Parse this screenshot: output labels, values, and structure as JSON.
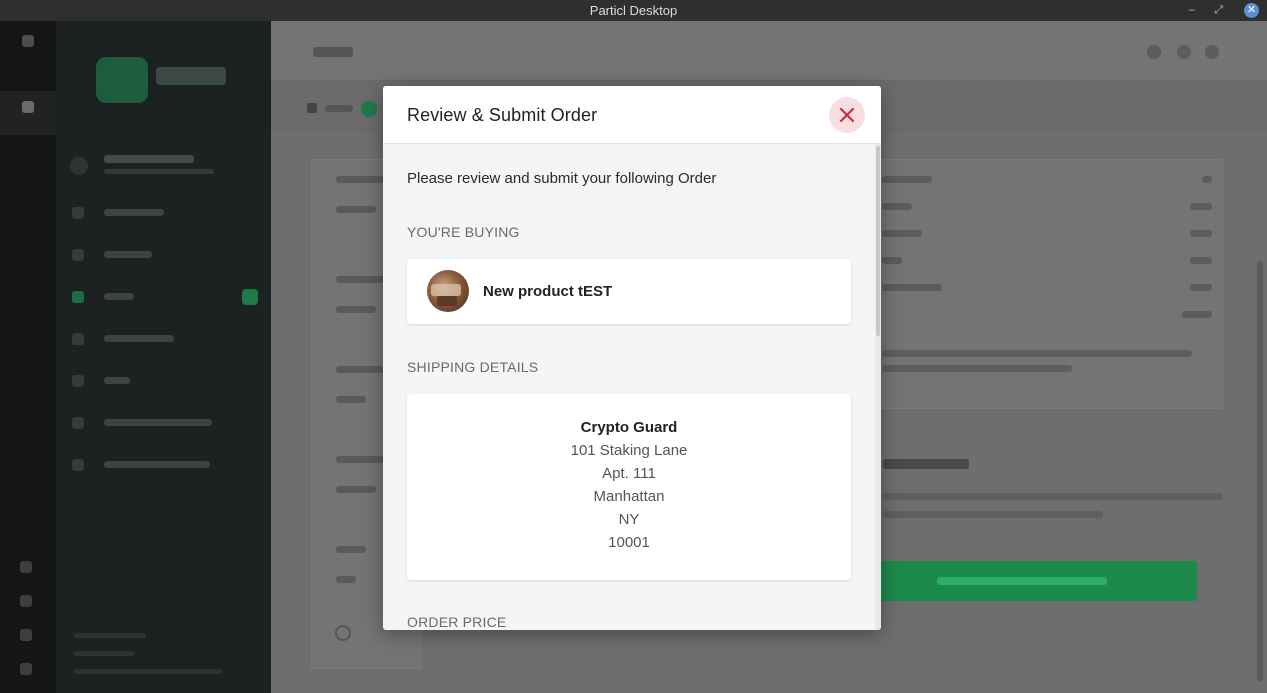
{
  "window": {
    "title": "Particl Desktop",
    "minimize_glyph": "–",
    "maximize_glyph": "⤢",
    "close_glyph": "✕"
  },
  "modal": {
    "title": "Review & Submit Order",
    "close_icon": "close-x-icon",
    "intro": "Please review and submit your following Order",
    "buying_label": "YOU'RE BUYING",
    "product": {
      "name": "New product tEST"
    },
    "shipping_label": "SHIPPING DETAILS",
    "shipping": {
      "name": "Crypto Guard",
      "line1": "101 Staking Lane",
      "line2": "Apt. 111",
      "city": "Manhattan",
      "state": "NY",
      "zip": "10001"
    },
    "price_label": "ORDER PRICE"
  },
  "colors": {
    "accent_green": "#1b8a4b",
    "close_red": "#d0253a",
    "close_bg": "#f7dfe1"
  }
}
